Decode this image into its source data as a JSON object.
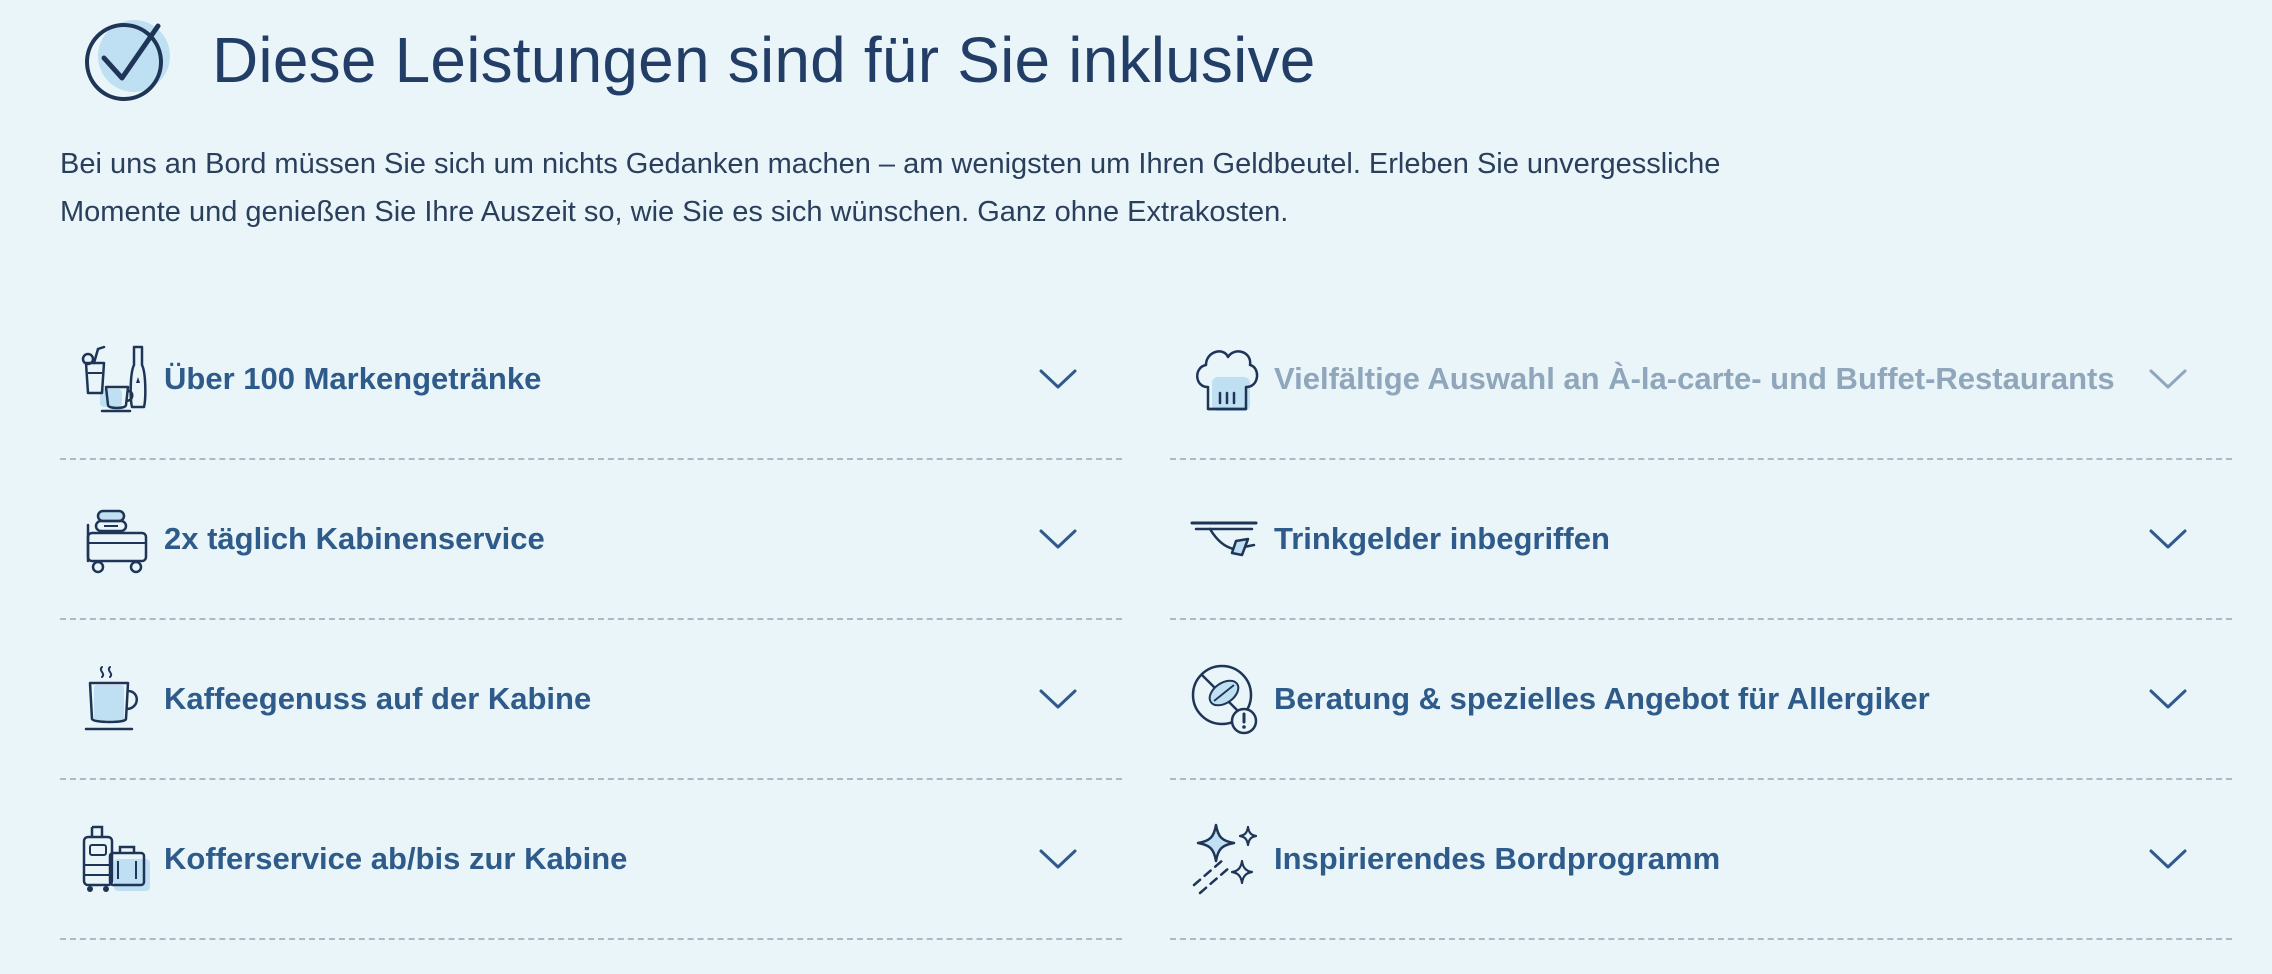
{
  "header": {
    "title": "Diese Leistungen sind für Sie inklusive"
  },
  "intro": {
    "line1": "Bei uns an Bord müssen Sie sich um nichts Gedanken machen – am wenigsten um Ihren Geldbeutel. Erleben Sie unvergessliche",
    "line2": "Momente und genießen Sie Ihre Auszeit so, wie Sie es sich wünschen. Ganz ohne Extrakosten."
  },
  "colors": {
    "accent": "#2e5b8a",
    "icon_fill": "#bfe0f2",
    "background": "#eaf5fa",
    "muted": "#8fa6bb"
  },
  "features": [
    {
      "label": "Über 100 Markengetränke",
      "icon": "drinks-icon"
    },
    {
      "label": "Vielfältige Auswahl an À-la-carte- und Buffet-Restaurants",
      "icon": "chef-hat-icon"
    },
    {
      "label": "2x täglich Kabinenservice",
      "icon": "housekeeping-cart-icon"
    },
    {
      "label": "Trinkgelder inbegriffen",
      "icon": "serving-tray-icon"
    },
    {
      "label": "Kaffeegenuss auf der Kabine",
      "icon": "coffee-cup-icon"
    },
    {
      "label": "Beratung & spezielles Angebot für Allergiker",
      "icon": "allergy-icon"
    },
    {
      "label": "Kofferservice ab/bis zur Kabine",
      "icon": "luggage-icon"
    },
    {
      "label": "Inspirierendes Bordprogramm",
      "icon": "sparkles-icon"
    }
  ]
}
